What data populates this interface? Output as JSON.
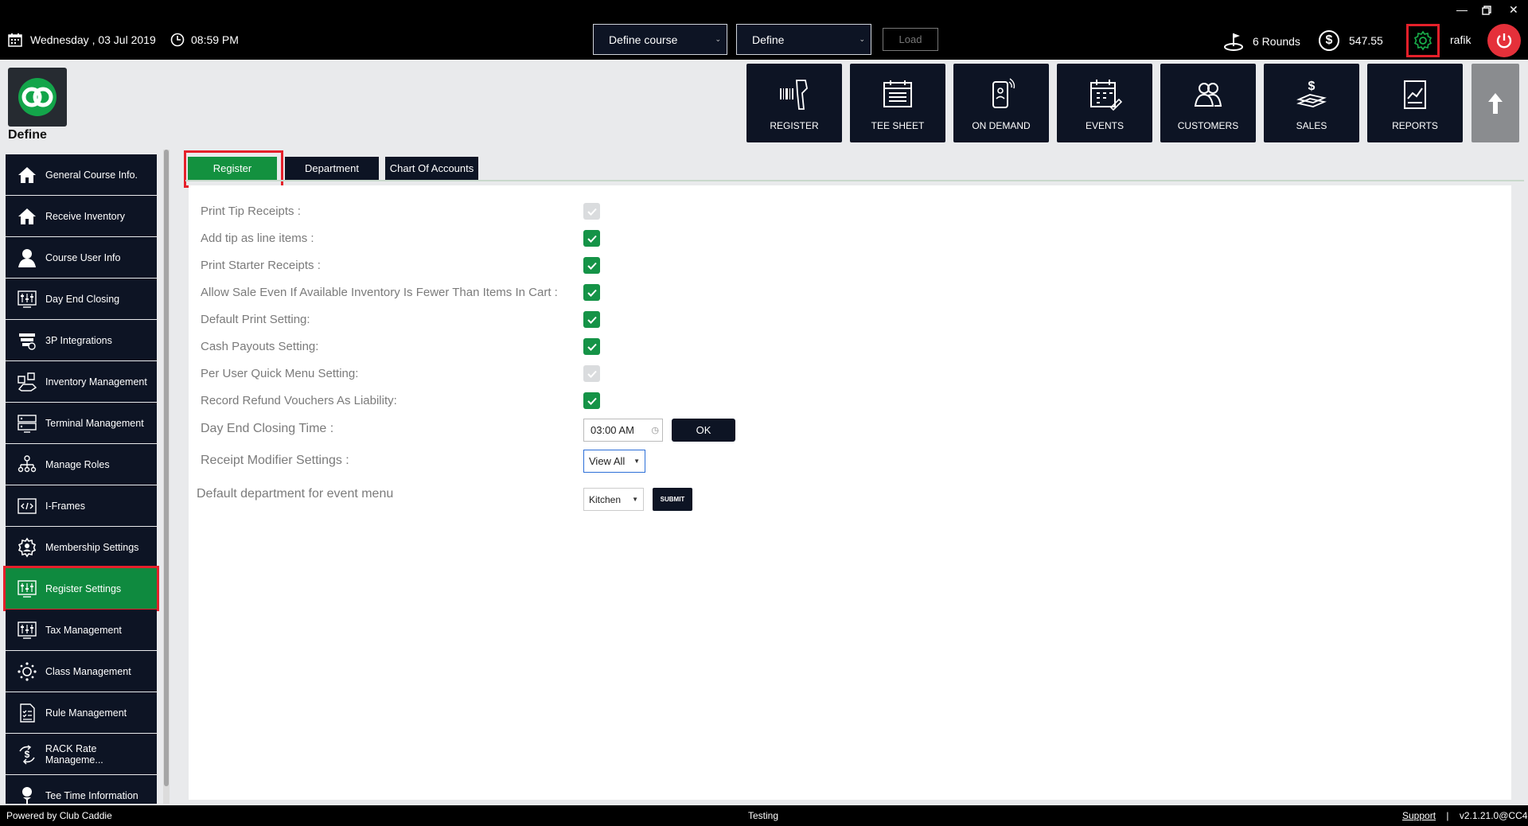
{
  "topbar": {
    "date": "Wednesday ,  03 Jul 2019",
    "time": "08:59 PM",
    "course_select": "Define course",
    "define_select": "Define",
    "load_label": "Load",
    "rounds": "6 Rounds",
    "balance": "547.55",
    "user": "rafik"
  },
  "app": {
    "title": "Define"
  },
  "tiles": [
    {
      "label": "REGISTER",
      "icon": "barcode-scanner-icon"
    },
    {
      "label": "TEE SHEET",
      "icon": "sheet-icon"
    },
    {
      "label": "ON DEMAND",
      "icon": "mobile-icon"
    },
    {
      "label": "EVENTS",
      "icon": "calendar-icon"
    },
    {
      "label": "CUSTOMERS",
      "icon": "users-icon"
    },
    {
      "label": "SALES",
      "icon": "money-icon"
    },
    {
      "label": "REPORTS",
      "icon": "report-icon"
    }
  ],
  "sidebar": {
    "items": [
      {
        "label": "General Course Info."
      },
      {
        "label": "Receive Inventory"
      },
      {
        "label": "Course User Info"
      },
      {
        "label": "Day End Closing"
      },
      {
        "label": "3P Integrations"
      },
      {
        "label": "Inventory Management"
      },
      {
        "label": "Terminal Management"
      },
      {
        "label": "Manage Roles"
      },
      {
        "label": "I-Frames"
      },
      {
        "label": "Membership Settings"
      },
      {
        "label": "Register Settings"
      },
      {
        "label": "Tax Management"
      },
      {
        "label": "Class Management"
      },
      {
        "label": "Rule Management"
      },
      {
        "label": "RACK Rate Manageme..."
      },
      {
        "label": "Tee Time Information"
      }
    ],
    "active_index": 10
  },
  "tabs": [
    {
      "label": "Register"
    },
    {
      "label": "Department"
    },
    {
      "label": "Chart Of Accounts"
    }
  ],
  "settings": {
    "print_tip_receipts": {
      "label": "Print Tip Receipts :",
      "checked": false
    },
    "add_tip_line_items": {
      "label": "Add tip as line items :",
      "checked": true
    },
    "print_starter_receipts": {
      "label": "Print Starter Receipts :",
      "checked": true
    },
    "allow_sale": {
      "label": "Allow Sale Even If Available Inventory Is Fewer Than Items In Cart :",
      "checked": true
    },
    "default_print": {
      "label": "Default Print Setting:",
      "checked": true
    },
    "cash_payouts": {
      "label": "Cash Payouts Setting:",
      "checked": true
    },
    "per_user_quick_menu": {
      "label": "Per User Quick Menu Setting:",
      "checked": false
    },
    "refund_vouchers": {
      "label": "Record Refund Vouchers As Liability:",
      "checked": true
    },
    "day_end_closing_time": {
      "label": "Day End Closing Time :",
      "value": "03:00 AM",
      "ok_label": "OK"
    },
    "receipt_modifier": {
      "label": "Receipt Modifier Settings :",
      "value": "View All"
    },
    "default_department": {
      "label": "Default department for event menu",
      "value": "Kitchen",
      "submit_label": "SUBMIT"
    }
  },
  "footer": {
    "powered_by": "Powered by Club Caddie",
    "environment": "Testing",
    "support": "Support",
    "separator": "|",
    "version": "v2.1.21.0@CC4"
  },
  "colors": {
    "accent_green": "#13913f",
    "navy": "#0d1424",
    "highlight_red": "#e5202a"
  }
}
